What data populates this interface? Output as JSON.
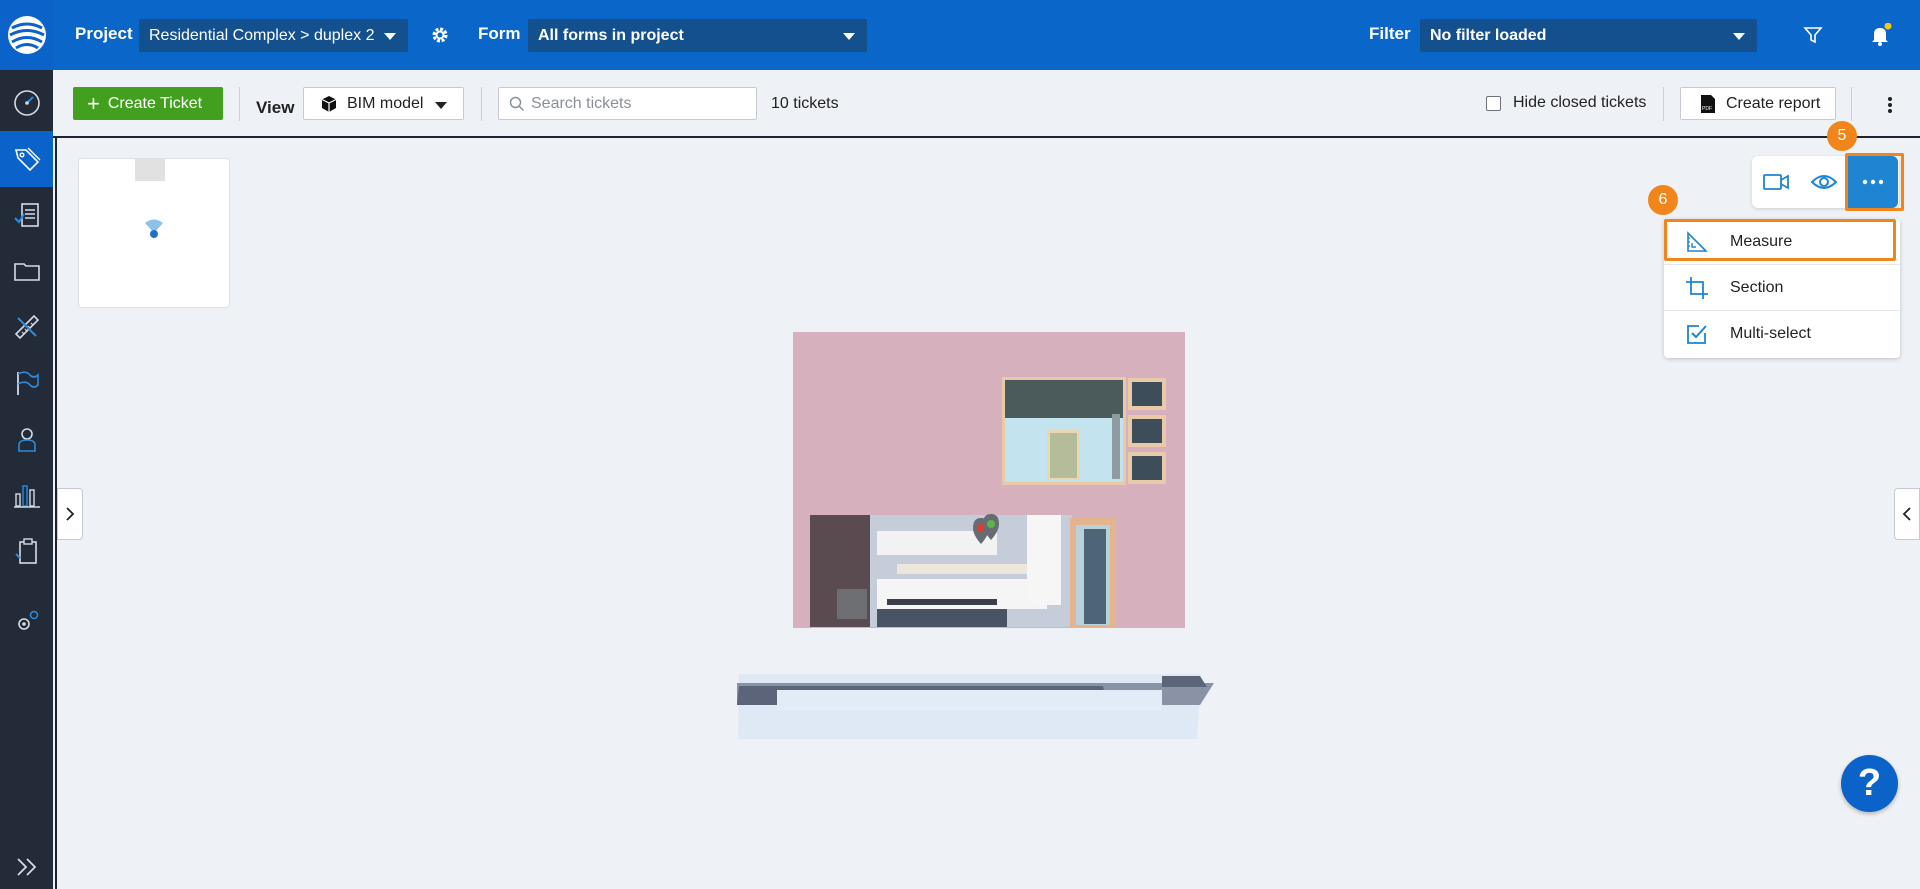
{
  "topbar": {
    "project_label": "Project",
    "project_value": "Residential Complex > duplex 2",
    "form_label": "Form",
    "form_value": "All forms in project",
    "filter_label": "Filter",
    "filter_value": "No filter loaded"
  },
  "toolbar": {
    "create_ticket_label": "Create Ticket",
    "view_label": "View",
    "view_value": "BIM model",
    "search_placeholder": "Search tickets",
    "ticket_count": "10 tickets",
    "hide_closed_label": "Hide closed tickets",
    "create_report_label": "Create report",
    "report_icon_text": "PDF"
  },
  "viewer_tools": {
    "menu": [
      {
        "label": "Measure",
        "icon": "measure-icon"
      },
      {
        "label": "Section",
        "icon": "crop-icon"
      },
      {
        "label": "Multi-select",
        "icon": "checkbox-checked-icon"
      }
    ]
  },
  "annotations": {
    "badge_more": "5",
    "badge_measure": "6"
  },
  "help": {
    "label": "?"
  },
  "colors": {
    "topbar": "#0a66c8",
    "sidebar": "#222b37",
    "accent_green": "#43a01f",
    "highlight_orange": "#f0851b",
    "tool_blue": "#1f84d2"
  }
}
